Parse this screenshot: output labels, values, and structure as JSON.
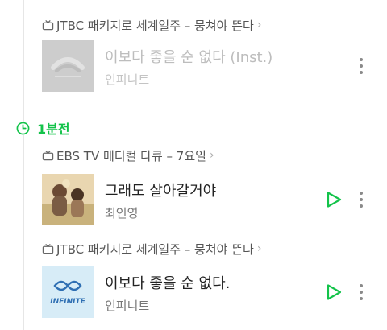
{
  "sections": {
    "first_program": {
      "label": "JTBC 패키지로 세계일주 – 뭉쳐야 뜬다",
      "chevron": "›"
    },
    "track1": {
      "title": "이보다 좋을 순 없다 (Inst.)",
      "artist": "인피니트"
    },
    "time_marker": {
      "label": "1분전"
    },
    "second_program": {
      "label": "EBS TV 메디컬 다큐 – 7요일",
      "chevron": "›"
    },
    "track2": {
      "title": "그래도 살아갈거야",
      "artist": "최인영"
    },
    "third_program": {
      "label": "JTBC 패키지로 세계일주 – 뭉쳐야 뜬다",
      "chevron": "›"
    },
    "track3": {
      "title": "이보다 좋을 순 없다.",
      "artist": "인피니트",
      "album_text": "INFINITE"
    }
  },
  "colors": {
    "accent": "#13c34a",
    "text": "#222222",
    "subtext": "#777777",
    "dim": "#bdbdbd"
  },
  "icons": [
    "tv-icon",
    "chevron-right-icon",
    "clock-icon",
    "play-icon",
    "more-vert-icon"
  ]
}
